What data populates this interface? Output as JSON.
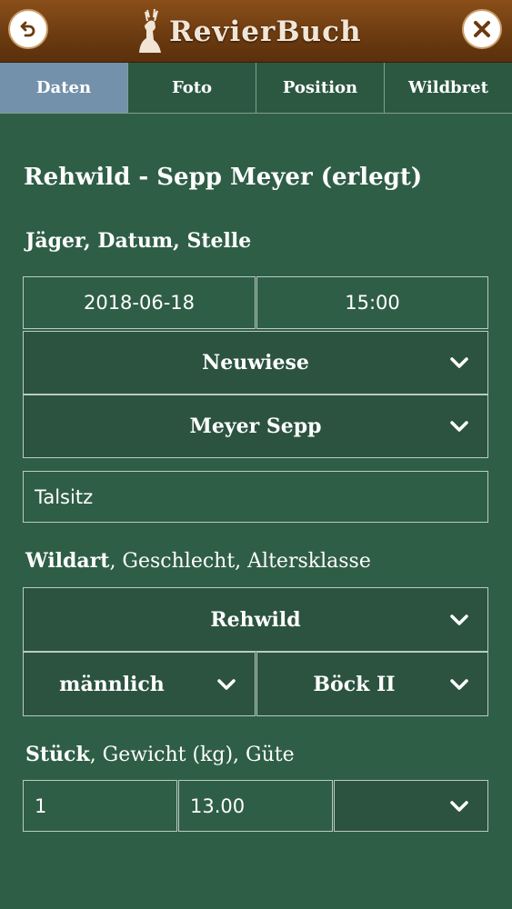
{
  "header": {
    "title": "RevierBuch",
    "back_icon": "back-arrow-icon",
    "close_icon": "close-icon",
    "logo_icon": "deer-logo-icon"
  },
  "tabs": [
    {
      "label": "Daten",
      "active": true
    },
    {
      "label": "Foto",
      "active": false
    },
    {
      "label": "Position",
      "active": false
    },
    {
      "label": "Wildbret",
      "active": false
    }
  ],
  "record_title": "Rehwild - Sepp Meyer (erlegt)",
  "section1": {
    "label_bold": "Jäger",
    "label_rest": ", Datum, Stelle",
    "date": "2018-06-18",
    "time": "15:00",
    "area": "Neuwiese",
    "hunter": "Meyer Sepp",
    "place": "Talsitz"
  },
  "section2": {
    "label_bold": "Wildart",
    "label_rest": ", Geschlecht, Altersklasse",
    "species": "Rehwild",
    "sex": "männlich",
    "age_class": "Böck II"
  },
  "section3": {
    "label_bold": "Stück",
    "label_rest": ", Gewicht (kg), Güte",
    "count": "1",
    "weight": "13.00",
    "quality": ""
  },
  "colors": {
    "background": "#2f5e46",
    "header": "#6b3a10",
    "active_tab": "#7391aa"
  }
}
